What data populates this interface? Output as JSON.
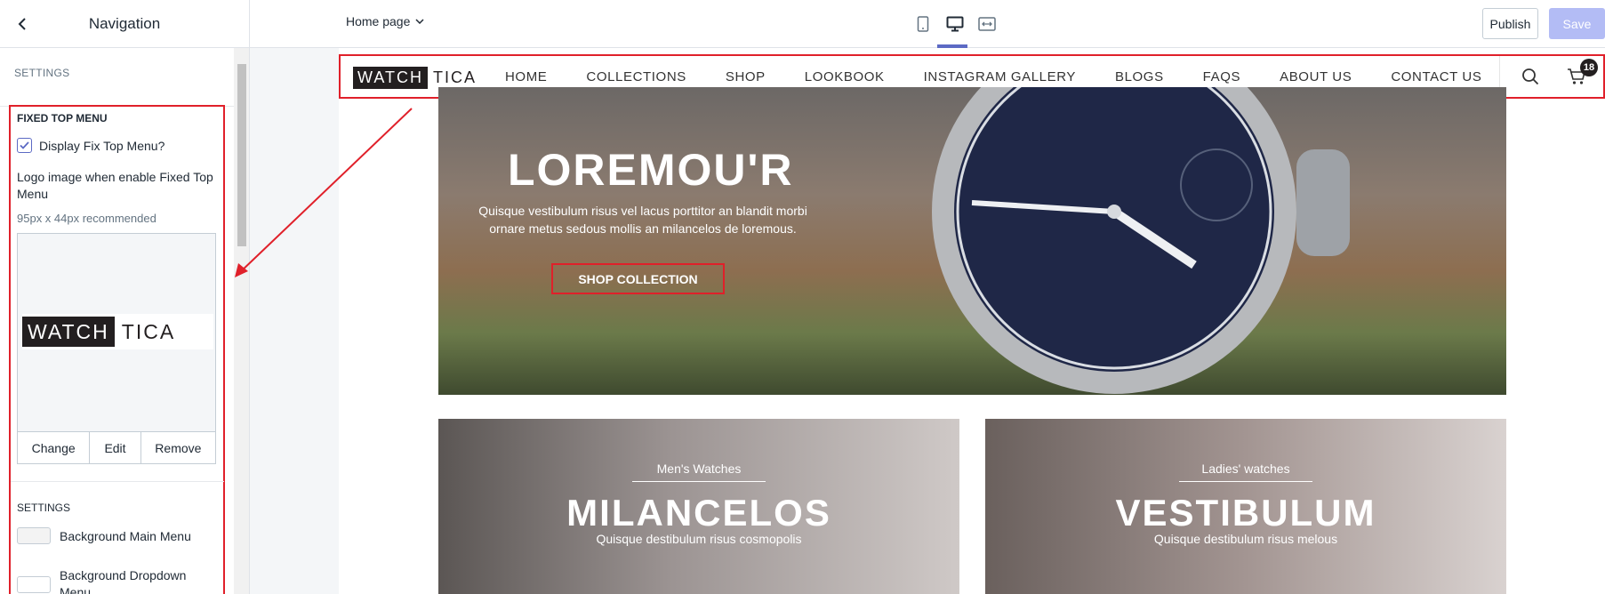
{
  "sidebar": {
    "title": "Navigation",
    "section_label": "SETTINGS",
    "fixed_menu": {
      "title": "FIXED TOP MENU",
      "checkbox_label": "Display Fix Top Menu?",
      "checkbox_checked": true,
      "logo_label": "Logo image when enable Fixed Top Menu",
      "logo_hint": "95px x 44px recommended",
      "logo_text_dark": "WATCH",
      "logo_text_light": "TICA",
      "buttons": [
        "Change",
        "Edit",
        "Remove"
      ]
    },
    "settings2": {
      "title": "SETTINGS",
      "rows": [
        "Background Main Menu",
        "Background Dropdown Menu"
      ]
    }
  },
  "topbar": {
    "page_select": "Home page",
    "publish_label": "Publish",
    "save_label": "Save"
  },
  "preview": {
    "logo_dark": "WATCH",
    "logo_light": "TICA",
    "nav_items": [
      "HOME",
      "COLLECTIONS",
      "SHOP",
      "LOOKBOOK",
      "INSTAGRAM GALLERY",
      "BLOGS",
      "FAQS",
      "ABOUT US",
      "CONTACT US"
    ],
    "cart_count": "18",
    "hero": {
      "title": "LOREMOU'R",
      "subtitle": "Quisque vestibulum risus vel lacus porttitor an blandit morbi ornare metus sedous mollis an milancelos de loremous.",
      "button": "SHOP COLLECTION"
    },
    "cards": [
      {
        "kicker": "Men's Watches",
        "title": "MILANCELOS",
        "subtitle": "Quisque destibulum risus cosmopolis"
      },
      {
        "kicker": "Ladies' watches",
        "title": "VESTIBULUM",
        "subtitle": "Quisque destibulum risus melous"
      }
    ]
  },
  "colors": {
    "accent": "#5c6ac4",
    "annotation_red": "#e0202a",
    "save_disabled": "#b3bcf5"
  }
}
